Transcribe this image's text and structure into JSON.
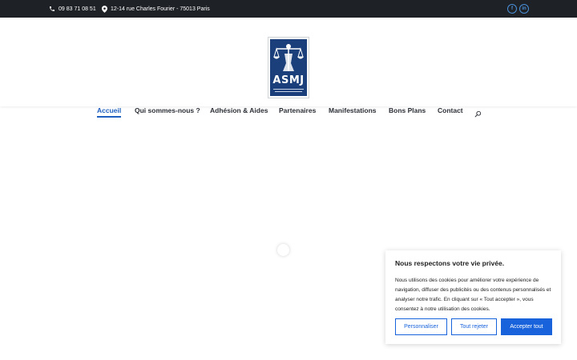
{
  "topbar": {
    "phone": "09 83 71 08 51",
    "address": "12-14 rue Charles Fourier - 75013 Paris",
    "social": {
      "facebook": "f",
      "linkedin": "in"
    }
  },
  "logo": {
    "text": "ASMJ"
  },
  "nav": {
    "items": [
      "Accueil",
      "Qui sommes-nous ?",
      "Adhésion & Aides",
      "Partenaires",
      "Manifestations",
      "Bons Plans",
      "Contact"
    ]
  },
  "cookie": {
    "title": "Nous respectons votre vie privée.",
    "text": "Nous utilisons des cookies pour améliorer votre expérience de navigation, diffuser des publicités ou des contenus personnalisés et analyser notre trafic. En cliquant sur « Tout accepter », vous consentez à notre utilisation des cookies.",
    "customize": "Personnaliser",
    "reject": "Tout rejeter",
    "accept": "Accepter tout"
  },
  "colors": {
    "accent": "#1f5fbf",
    "topbar": "#1e2126",
    "cookie_button": "#1863dc"
  }
}
